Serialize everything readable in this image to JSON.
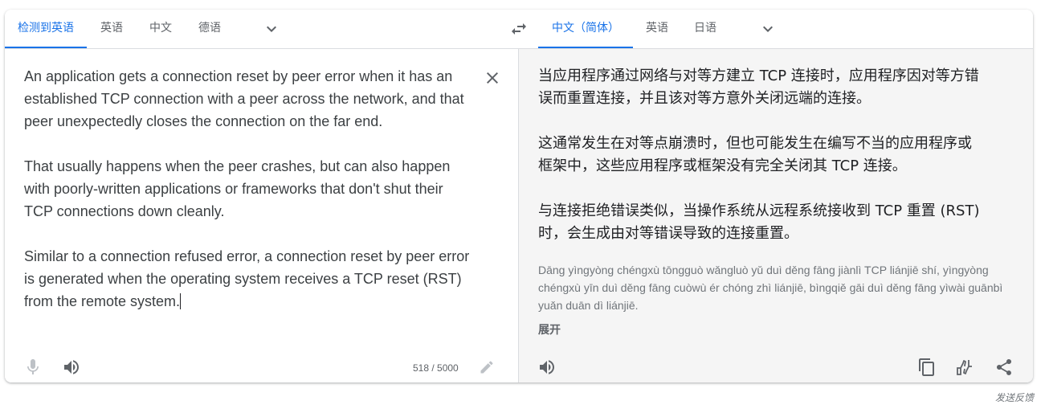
{
  "source_tabs": [
    "检测到英语",
    "英语",
    "中文",
    "德语"
  ],
  "target_tabs": [
    "中文（简体）",
    "英语",
    "日语"
  ],
  "source": {
    "text": "An application gets a connection reset by peer error when it has an\nestablished TCP connection with a peer across the network, and that\npeer unexpectedly closes the connection on the far end.\n\nThat usually happens when the peer crashes, but can also happen\nwith poorly-written applications or frameworks that don't shut their\nTCP connections down cleanly.\n\nSimilar to a connection refused error, a connection reset by peer error\nis generated when the operating system receives a TCP reset (RST)\nfrom the remote system.",
    "char_count": "518 / 5000"
  },
  "target": {
    "text": "当应用程序通过网络与对等方建立 TCP 连接时，应用程序因对等方错\n误而重置连接，并且该对等方意外关闭远端的连接。\n\n这通常发生在对等点崩溃时，但也可能发生在编写不当的应用程序或\n框架中，这些应用程序或框架没有完全关闭其 TCP 连接。\n\n与连接拒绝错误类似，当操作系统从远程系统接收到 TCP 重置 (RST)\n时，会生成由对等错误导致的连接重置。",
    "transliteration": "Dāng yìngyòng chéngxù tōngguò wǎngluò yǔ duì děng fāng jiànlì TCP liánjiē shí, yìngyòng chéngxù yīn duì děng fāng cuòwù ér chóng zhì liánjiē, bìngqiě gāi duì děng fāng yìwài guānbì yuǎn duān dì liánjiē.",
    "expand_label": "展开"
  },
  "feedback_label": "发送反馈",
  "colors": {
    "accent": "#1a73e8",
    "icon": "#5f6368",
    "target_bg": "#f5f5f5"
  }
}
